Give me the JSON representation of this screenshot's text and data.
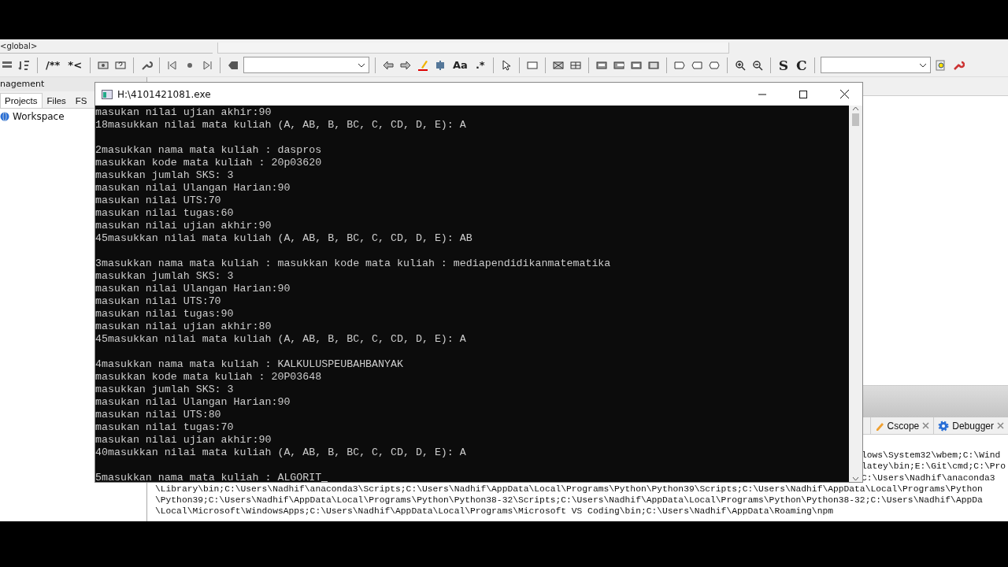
{
  "ide": {
    "scope_combo": "<global>",
    "toolbar_glyphs": [
      "/**",
      "*<",
      "Aa",
      ".*",
      "S",
      "C"
    ],
    "left_panel": {
      "title": "nagement",
      "tabs": [
        {
          "label": "Projects",
          "selected": true
        },
        {
          "label": "Files",
          "selected": false
        },
        {
          "label": "FS",
          "selected": false
        }
      ],
      "tree": [
        {
          "label": "Workspace"
        }
      ]
    },
    "bottom_tabs": [
      {
        "label": "Cscope",
        "kind": "pencil"
      },
      {
        "label": "Debugger",
        "kind": "gear"
      }
    ],
    "log_lines": [
      {
        "kind": "clipped",
        "text": "lows\\System32\\wbem;C:\\Wind"
      },
      {
        "kind": "clipped",
        "text": "latey\\bin;E:\\Git\\cmd;C:\\Pro"
      },
      {
        "kind": "clipped",
        "text": "C:\\Users\\Nadhif\\anaconda3"
      },
      {
        "kind": "full",
        "text": "\\Library\\bin;C:\\Users\\Nadhif\\anaconda3\\Scripts;C:\\Users\\Nadhif\\AppData\\Local\\Programs\\Python\\Python39\\Scripts;C:\\Users\\Nadhif\\AppData\\Local\\Programs\\Python"
      },
      {
        "kind": "full",
        "text": "\\Python39;C:\\Users\\Nadhif\\AppData\\Local\\Programs\\Python\\Python38-32\\Scripts;C:\\Users\\Nadhif\\AppData\\Local\\Programs\\Python\\Python38-32;C:\\Users\\Nadhif\\AppDa"
      },
      {
        "kind": "full",
        "text": "\\Local\\Microsoft\\WindowsApps;C:\\Users\\Nadhif\\AppData\\Local\\Programs\\Microsoft VS Coding\\bin;C:\\Users\\Nadhif\\AppData\\Roaming\\npm"
      }
    ]
  },
  "console": {
    "title": "H:\\4101421081.exe",
    "blocks": [
      [
        "masukan nilai ujian akhir:90",
        "18masukkan nilai mata kuliah (A, AB, B, BC, C, CD, D, E): A"
      ],
      [
        "2masukkan nama mata kuliah : daspros",
        "masukkan kode mata kuliah : 20p03620",
        "masukkan jumlah SKS: 3",
        "masukan nilai Ulangan Harian:90",
        "masukan nilai UTS:70",
        "masukan nilai tugas:60",
        "masukan nilai ujian akhir:90",
        "45masukkan nilai mata kuliah (A, AB, B, BC, C, CD, D, E): AB"
      ],
      [
        "3masukkan nama mata kuliah : masukkan kode mata kuliah : mediapendidikanmatematika",
        "masukkan jumlah SKS: 3",
        "masukan nilai Ulangan Harian:90",
        "masukan nilai UTS:70",
        "masukan nilai tugas:90",
        "masukan nilai ujian akhir:80",
        "45masukkan nilai mata kuliah (A, AB, B, BC, C, CD, D, E): A"
      ],
      [
        "4masukkan nama mata kuliah : KALKULUSPEUBAHBANYAK",
        "masukkan kode mata kuliah : 20P03648",
        "masukkan jumlah SKS: 3",
        "masukan nilai Ulangan Harian:90",
        "masukan nilai UTS:80",
        "masukan nilai tugas:70",
        "masukan nilai ujian akhir:90",
        "40masukkan nilai mata kuliah (A, AB, B, BC, C, CD, D, E): A"
      ],
      [
        "5masukkan nama mata kuliah : ALGORIT"
      ]
    ]
  }
}
